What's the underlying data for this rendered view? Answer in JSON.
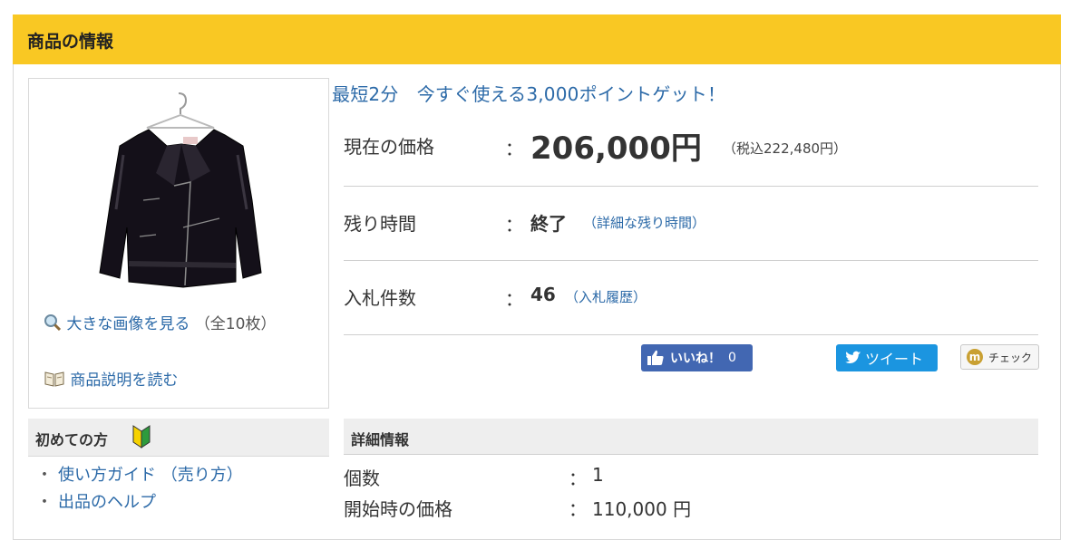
{
  "header": {
    "title": "商品の情報"
  },
  "image_panel": {
    "view_large_label": "大きな画像を見る",
    "image_count": "（全10枚）",
    "read_description_label": "商品説明を読む"
  },
  "beginners": {
    "title": "初めての方",
    "links": [
      "使い方ガイド （売り方）",
      "出品のヘルプ"
    ]
  },
  "promo": {
    "text": "最短2分　今すぐ使える3,000ポイントゲット！"
  },
  "price": {
    "label": "現在の価格",
    "colon": "：",
    "value": "206,000円",
    "tax_note": "（税込222,480円）"
  },
  "time_left": {
    "label": "残り時間",
    "colon": "：",
    "value": "終了",
    "link": "（詳細な残り時間）"
  },
  "bids": {
    "label": "入札件数",
    "colon": "：",
    "value": "46",
    "link": "（入札履歴）"
  },
  "social": {
    "facebook_label": "いいね！",
    "facebook_count": "0",
    "twitter_label": "ツイート",
    "check_label": "チェック",
    "facebook_color": "#4267b2",
    "twitter_color": "#1b95e0"
  },
  "details": {
    "title": "詳細情報",
    "rows": [
      {
        "label": "個数",
        "colon": "：",
        "value": "1"
      },
      {
        "label": "開始時の価格",
        "colon": "：",
        "value": "110,000 円"
      }
    ]
  },
  "colors": {
    "header_bg": "#f9c823",
    "link": "#2c6aa8"
  }
}
